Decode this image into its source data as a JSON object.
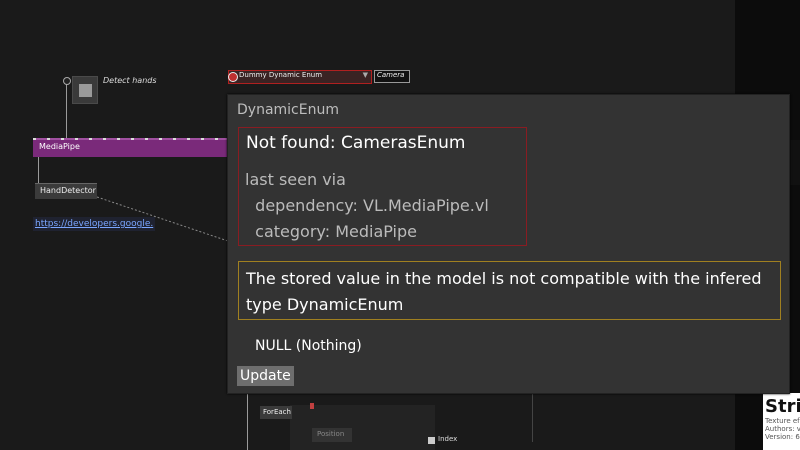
{
  "canvas": {
    "toggle_label": "Detect hands",
    "mediapipe_label": "MediaPipe",
    "handdetector_label": "HandDetector",
    "link_text": "https://developers.google.",
    "enum_node_label": "Dummy Dynamic Enum",
    "camera_label": "Camera",
    "foreach_label": "ForEach",
    "position_label": "Position",
    "index_label": "Index"
  },
  "tooltip": {
    "title": "DynamicEnum",
    "not_found": "Not found: CamerasEnum",
    "last_seen": "last seen via",
    "dependency": "  dependency: VL.MediaPipe.vl",
    "category": "  category: MediaPipe",
    "warning": "The stored value in the model is not compatible with the infered type DynamicEnum",
    "null_value": "NULL (Nothing)",
    "update_label": "Update"
  },
  "right_panel": {
    "card_title": "Strid",
    "card_line1": "Texture ef",
    "card_line2": "Authors: v",
    "card_line3": "Version: 6"
  },
  "colors": {
    "error_border": "#8a1c22",
    "warning_border": "#a08020",
    "mediapipe_bar": "#7a2a7a",
    "link": "#7aa6ff"
  }
}
